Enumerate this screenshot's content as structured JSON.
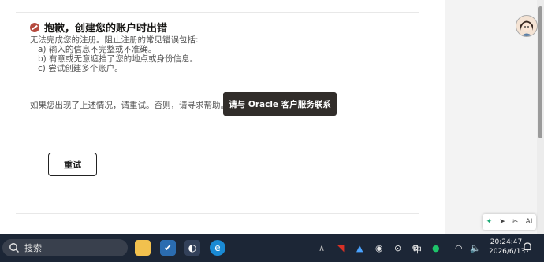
{
  "error": {
    "title": "抱歉，创建您的账户时出错",
    "intro": "无法完成您的注册。阻止注册的常见错误包括:",
    "items": [
      "a) 输入的信息不完整或不准确。",
      "b) 有意或无意遮挡了您的地点或身份信息。",
      "c) 尝试创建多个账户。"
    ],
    "help_text": "如果您出现了上述情况，请重试。否则，请寻求帮助。",
    "contact_button": "请与 Oracle 客户服务联系",
    "retry_button": "重试"
  },
  "side_tools": [
    "translate-icon",
    "send-icon",
    "scissors-icon",
    "ai-text-icon"
  ],
  "ai_label": "AI",
  "taskbar": {
    "search_placeholder": "搜索",
    "ime": "中",
    "time": "20:24:47",
    "date": "2026/6/13"
  }
}
